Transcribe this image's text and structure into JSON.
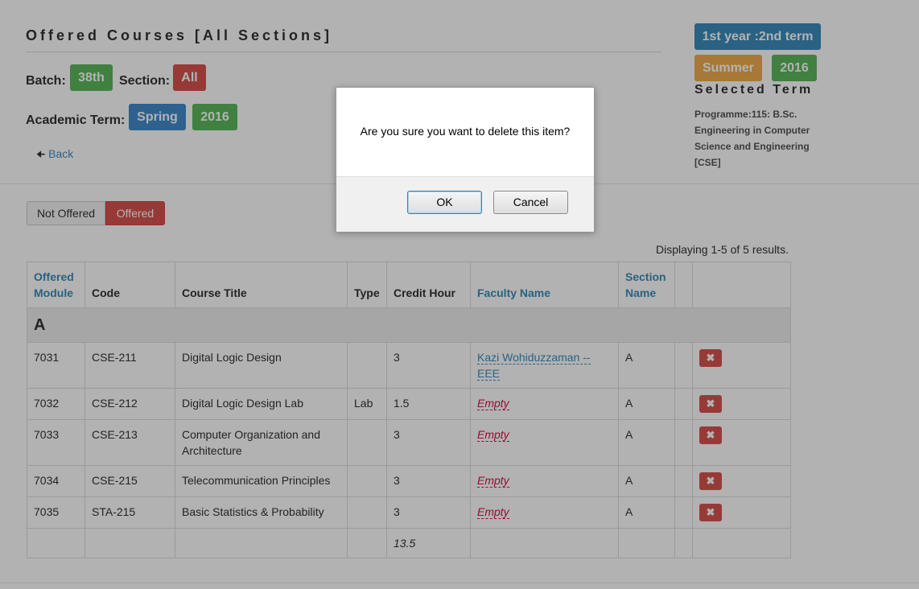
{
  "header": {
    "title": "Offered Courses [All Sections]",
    "batch_label": "Batch:",
    "batch_value": "38th",
    "section_label": "Section:",
    "section_value": "All",
    "academic_term_label": "Academic Term:",
    "term_value": "Spring",
    "term_year": "2016",
    "back_label": "Back"
  },
  "side": {
    "year_term": "1st year :2nd term",
    "selected_season": "Summer",
    "selected_year": "2016",
    "selected_term_label": "Selected Term",
    "programme": "Programme:115: B.Sc. Engineering in Computer Science and Engineering [CSE]"
  },
  "toggle": {
    "not_offered": "Not Offered",
    "offered": "Offered"
  },
  "summary": "Displaying 1-5 of 5 results.",
  "table": {
    "columns": [
      "Offered Module",
      "Code",
      "Course Title",
      "Type",
      "Credit Hour",
      "Faculty Name",
      "Section Name",
      "",
      ""
    ],
    "group": "A",
    "rows": [
      {
        "module": "7031",
        "code": "CSE-211",
        "title": "Digital Logic Design",
        "type": "",
        "credit": "3",
        "faculty": "Kazi Wohiduzzaman -- EEE",
        "faculty_empty": false,
        "section": "A"
      },
      {
        "module": "7032",
        "code": "CSE-212",
        "title": "Digital Logic Design Lab",
        "type": "Lab",
        "credit": "1.5",
        "faculty": "Empty",
        "faculty_empty": true,
        "section": "A"
      },
      {
        "module": "7033",
        "code": "CSE-213",
        "title": "Computer Organization and Architecture",
        "type": "",
        "credit": "3",
        "faculty": "Empty",
        "faculty_empty": true,
        "section": "A"
      },
      {
        "module": "7034",
        "code": "CSE-215",
        "title": "Telecommunication Principles",
        "type": "",
        "credit": "3",
        "faculty": "Empty",
        "faculty_empty": true,
        "section": "A"
      },
      {
        "module": "7035",
        "code": "STA-215",
        "title": "Basic Statistics & Probability",
        "type": "",
        "credit": "3",
        "faculty": "Empty",
        "faculty_empty": true,
        "section": "A"
      }
    ],
    "total_credit": "13.5",
    "delete_icon": "times-icon"
  },
  "dialog": {
    "message": "Are you sure you want to delete this item?",
    "ok_label": "OK",
    "cancel_label": "Cancel"
  },
  "colors": {
    "green": "#5cb85c",
    "red": "#d9534f",
    "blue": "#428bca",
    "orange": "#f0ad4e",
    "link": "#3c8dbc",
    "empty": "#dd1144"
  }
}
